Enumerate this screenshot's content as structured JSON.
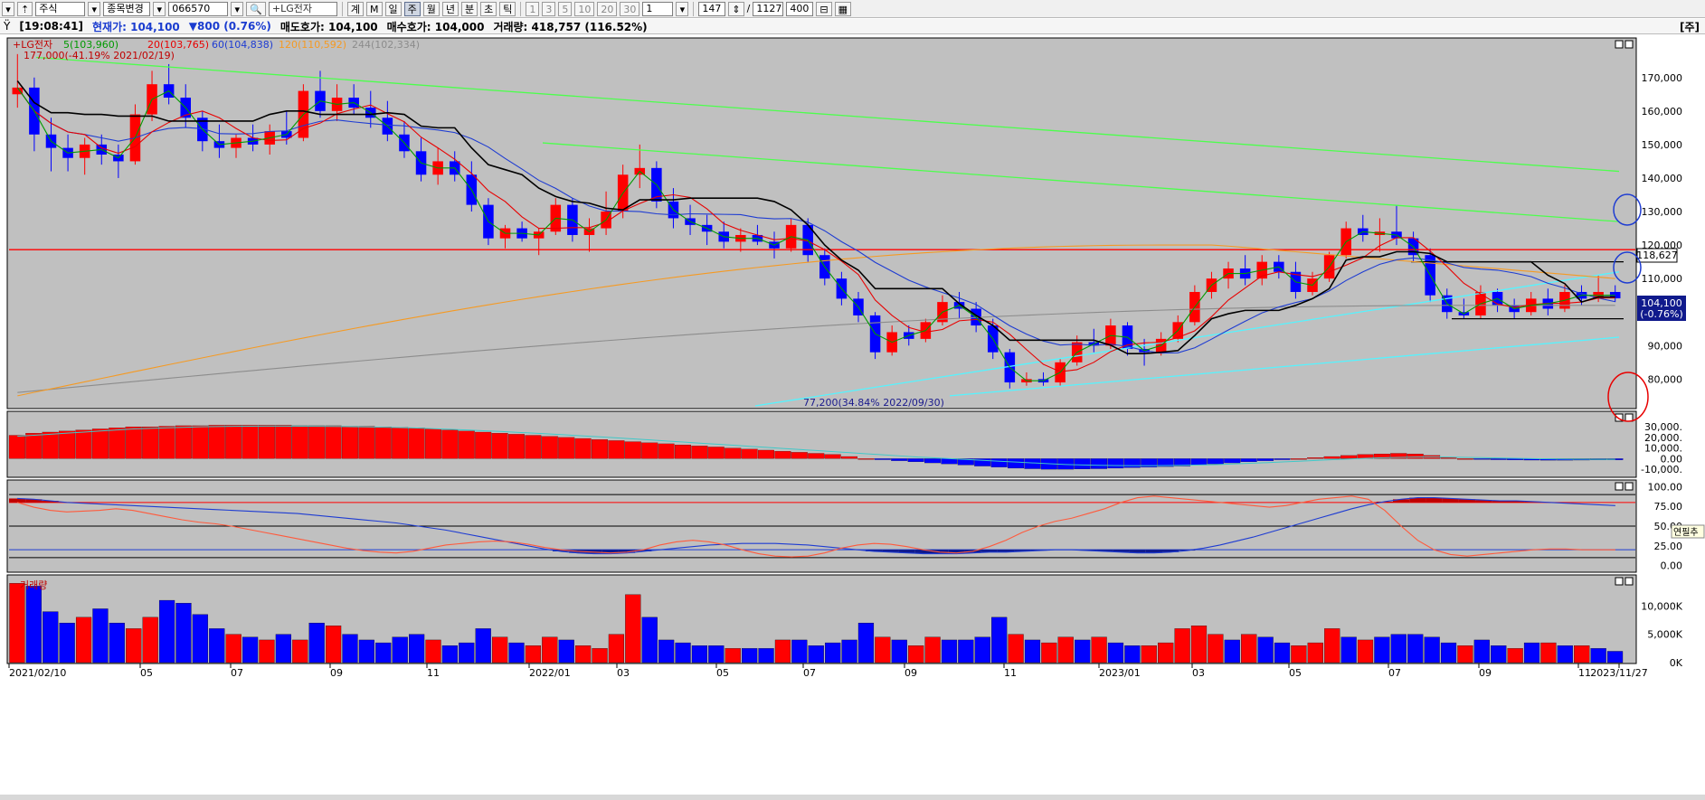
{
  "toolbar": {
    "market": "주식",
    "change_btn": "종목변경",
    "code": "066570",
    "name": "+LG전자",
    "periods": [
      "계",
      "M",
      "일",
      "주",
      "월",
      "년",
      "분",
      "초",
      "틱"
    ],
    "active_period": "주",
    "multipliers": [
      "1",
      "3",
      "5",
      "10",
      "20",
      "30"
    ],
    "unit": "1",
    "count": "147",
    "total": "1127",
    "view": "400"
  },
  "infobar": {
    "time": "[19:08:41]",
    "price_label": "현재가: 104,100",
    "change": "▼800 (0.76%)",
    "ask": "매도호가: 104,100",
    "bid": "매수호가: 104,000",
    "volume": "거래량: 418,757 (116.52%)",
    "right": "[주]"
  },
  "chart_data": [
    {
      "type": "candlestick",
      "title": "+LG전자",
      "legend": [
        "5(103,960)",
        "20(103,765)",
        "60(104,838)",
        "120(110,592)",
        "244(102,334)"
      ],
      "colors": {
        "up": "#ff0000",
        "down": "#0000ff",
        "ma5": "#009a00",
        "ma20": "#e80000",
        "ma60": "#1e3cd2",
        "ma120": "#f59a23",
        "ma244": "#8c8c8c",
        "ichimoku": "#000000",
        "hline": "#ff0000",
        "trend_green": "#4cff4c",
        "trend_cyan": "#54f4ff"
      },
      "high_note": "177,000(-41.19% 2021/02/19)",
      "low_note": "77,200(34.84% 2022/09/30)",
      "hline_label": "118,627",
      "price_label": [
        "104,100",
        "(-0.76%)"
      ],
      "ylim": [
        72000,
        181000
      ],
      "yticks": [
        "170,000",
        "160,000",
        "150,000",
        "140,000",
        "130,000",
        "120,000",
        "110,000",
        "100,000",
        "90,000",
        "80,000"
      ],
      "ytick_values": [
        170000,
        160000,
        150000,
        140000,
        130000,
        120000,
        110000,
        100000,
        90000,
        80000
      ],
      "x_dates": [
        "2021/02/10",
        "05",
        "07",
        "09",
        "11",
        "2022/01",
        "03",
        "05",
        "07",
        "09",
        "11",
        "2023/01",
        "03",
        "05",
        "07",
        "09",
        "11",
        "2023/11/27"
      ],
      "ohlc": [
        [
          165000,
          177000,
          161000,
          167000
        ],
        [
          167000,
          170000,
          148000,
          153000
        ],
        [
          153000,
          158000,
          142000,
          149000
        ],
        [
          149000,
          153000,
          142000,
          146000
        ],
        [
          146000,
          152000,
          141000,
          150000
        ],
        [
          150000,
          153000,
          144000,
          147000
        ],
        [
          147000,
          150000,
          140000,
          145000
        ],
        [
          145000,
          162000,
          144000,
          159000
        ],
        [
          159000,
          172000,
          157000,
          168000
        ],
        [
          168000,
          174000,
          162000,
          164000
        ],
        [
          164000,
          168000,
          155000,
          158000
        ],
        [
          158000,
          160000,
          148000,
          151000
        ],
        [
          151000,
          156000,
          146000,
          149000
        ],
        [
          149000,
          153000,
          146000,
          152000
        ],
        [
          152000,
          156000,
          148000,
          150000
        ],
        [
          150000,
          156000,
          147000,
          154000
        ],
        [
          154000,
          160000,
          150000,
          152000
        ],
        [
          152000,
          168000,
          151000,
          166000
        ],
        [
          166000,
          172000,
          158000,
          160000
        ],
        [
          160000,
          168000,
          157000,
          164000
        ],
        [
          164000,
          168000,
          159000,
          161000
        ],
        [
          161000,
          166000,
          155000,
          158000
        ],
        [
          158000,
          163000,
          151000,
          153000
        ],
        [
          153000,
          157000,
          146000,
          148000
        ],
        [
          148000,
          152000,
          139000,
          141000
        ],
        [
          141000,
          149000,
          138000,
          145000
        ],
        [
          145000,
          148000,
          139000,
          141000
        ],
        [
          141000,
          145000,
          130000,
          132000
        ],
        [
          132000,
          134000,
          120000,
          122000
        ],
        [
          122000,
          126000,
          119000,
          125000
        ],
        [
          125000,
          127000,
          121000,
          122000
        ],
        [
          122000,
          125000,
          117000,
          124000
        ],
        [
          124000,
          134000,
          123000,
          132000
        ],
        [
          132000,
          134000,
          121000,
          123000
        ],
        [
          123000,
          128000,
          118000,
          125000
        ],
        [
          125000,
          136000,
          123000,
          130000
        ],
        [
          130000,
          144000,
          128000,
          141000
        ],
        [
          141000,
          150000,
          137000,
          143000
        ],
        [
          143000,
          145000,
          131000,
          133000
        ],
        [
          133000,
          137000,
          125000,
          128000
        ],
        [
          128000,
          132000,
          123000,
          126000
        ],
        [
          126000,
          129000,
          120000,
          124000
        ],
        [
          124000,
          127000,
          119000,
          121000
        ],
        [
          121000,
          125000,
          118000,
          123000
        ],
        [
          123000,
          126000,
          120000,
          121000
        ],
        [
          121000,
          124000,
          116000,
          119000
        ],
        [
          119000,
          128000,
          118000,
          126000
        ],
        [
          126000,
          128000,
          115000,
          117000
        ],
        [
          117000,
          119000,
          108000,
          110000
        ],
        [
          110000,
          112000,
          102000,
          104000
        ],
        [
          104000,
          106000,
          97000,
          99000
        ],
        [
          99000,
          100000,
          86000,
          88000
        ],
        [
          88000,
          96000,
          87000,
          94000
        ],
        [
          94000,
          96000,
          90000,
          92000
        ],
        [
          92000,
          98000,
          91000,
          97000
        ],
        [
          97000,
          105000,
          96000,
          103000
        ],
        [
          103000,
          106000,
          98000,
          101000
        ],
        [
          101000,
          103000,
          94000,
          96000
        ],
        [
          96000,
          98000,
          86000,
          88000
        ],
        [
          88000,
          89000,
          77200,
          79000
        ],
        [
          79000,
          82000,
          78000,
          80000
        ],
        [
          80000,
          82000,
          78000,
          79000
        ],
        [
          79000,
          86000,
          78000,
          85000
        ],
        [
          85000,
          93000,
          84000,
          91000
        ],
        [
          91000,
          95000,
          88000,
          90000
        ],
        [
          90000,
          98000,
          89000,
          96000
        ],
        [
          96000,
          97000,
          87000,
          89000
        ],
        [
          89000,
          92000,
          84000,
          88000
        ],
        [
          88000,
          94000,
          87000,
          92000
        ],
        [
          92000,
          99000,
          91000,
          97000
        ],
        [
          97000,
          108000,
          96000,
          106000
        ],
        [
          106000,
          112000,
          104000,
          110000
        ],
        [
          110000,
          115000,
          107000,
          113000
        ],
        [
          113000,
          117000,
          108000,
          110000
        ],
        [
          110000,
          117000,
          108000,
          115000
        ],
        [
          115000,
          117000,
          110000,
          112000
        ],
        [
          112000,
          115000,
          104000,
          106000
        ],
        [
          106000,
          112000,
          105000,
          110000
        ],
        [
          110000,
          118000,
          109000,
          117000
        ],
        [
          117000,
          127000,
          116000,
          125000
        ],
        [
          125000,
          129000,
          121000,
          123000
        ],
        [
          123000,
          128000,
          118000,
          124000
        ],
        [
          124000,
          132000,
          120000,
          122000
        ],
        [
          122000,
          124000,
          115000,
          117000
        ],
        [
          117000,
          119000,
          103000,
          105000
        ],
        [
          105000,
          107000,
          98000,
          100000
        ],
        [
          100000,
          104000,
          98000,
          99000
        ],
        [
          99000,
          108000,
          98000,
          106000
        ],
        [
          106000,
          107000,
          100000,
          102000
        ],
        [
          102000,
          104000,
          98000,
          100000
        ],
        [
          100000,
          106000,
          99000,
          104000
        ],
        [
          104000,
          107000,
          99000,
          101000
        ],
        [
          101000,
          108000,
          100000,
          106000
        ],
        [
          106000,
          108000,
          102000,
          104000
        ],
        [
          104000,
          111000,
          103000,
          106000
        ],
        [
          106000,
          108000,
          103000,
          104100
        ]
      ]
    },
    {
      "type": "histogram",
      "yticks": [
        "30,000.",
        "20,000.",
        "10,000.",
        "0.00",
        "-10,000."
      ],
      "ytick_values": [
        30000,
        20000,
        10000,
        0,
        -10000
      ],
      "ylim": [
        -15000,
        42000
      ],
      "tooltip": "연필추",
      "values": [
        22000,
        24000,
        25000,
        26000,
        27000,
        28000,
        29000,
        30000,
        30000,
        30500,
        31000,
        31000,
        31500,
        31500,
        31500,
        31500,
        31500,
        31000,
        31000,
        31000,
        30500,
        30500,
        30000,
        29500,
        29000,
        28000,
        27000,
        26000,
        25000,
        24000,
        23000,
        22000,
        21000,
        20000,
        19000,
        18000,
        17000,
        16000,
        15000,
        14000,
        13000,
        12000,
        11000,
        10000,
        9000,
        8000,
        7000,
        6000,
        5000,
        4000,
        2000,
        0,
        -1000,
        -2000,
        -3000,
        -4000,
        -5000,
        -6000,
        -7000,
        -8000,
        -9000,
        -9500,
        -10000,
        -10000,
        -9800,
        -9500,
        -9000,
        -8500,
        -8000,
        -7500,
        -7000,
        -6000,
        -5000,
        -4000,
        -3000,
        -2000,
        -1000,
        0,
        1000,
        2000,
        3000,
        4000,
        4500,
        5000,
        4500,
        3000,
        1000,
        0,
        -500,
        -1000,
        -1200,
        -1400,
        -1500,
        -1500,
        -1400,
        -1300,
        -1200
      ],
      "signal": [
        21000,
        22000,
        23000,
        24000,
        25000,
        26000,
        27000,
        28000,
        28500,
        29000,
        29500,
        30000,
        30200,
        30400,
        30500,
        30600,
        30600,
        30500,
        30400,
        30300,
        30100,
        29900,
        29600,
        29200,
        28800,
        28200,
        27600,
        27000,
        26300,
        25600,
        24800,
        24000,
        23200,
        22300,
        21400,
        20500,
        19600,
        18600,
        17600,
        16600,
        15600,
        14600,
        13600,
        12600,
        11600,
        10600,
        9600,
        8600,
        7600,
        6600,
        5600,
        4600,
        3600,
        2600,
        1600,
        800,
        0,
        -800,
        -1600,
        -2400,
        -3200,
        -4000,
        -4800,
        -5500,
        -6000,
        -6300,
        -6500,
        -6600,
        -6600,
        -6500,
        -6300,
        -6000,
        -5600,
        -5000,
        -4400,
        -3800,
        -3100,
        -2400,
        -1700,
        -1000,
        -300,
        300,
        800,
        1200,
        1500,
        1600,
        1500,
        1200,
        900,
        600,
        300,
        0,
        -200,
        -400,
        -500,
        -600,
        -650
      ]
    },
    {
      "type": "line",
      "yticks": [
        "100.00",
        "75.00",
        "50.00",
        "25.00",
        "0.00"
      ],
      "ytick_values": [
        100,
        75,
        50,
        25,
        0
      ],
      "ylim": [
        -5,
        105
      ],
      "hlines": [
        90,
        80,
        50,
        20,
        10
      ],
      "series": [
        {
          "values": [
            85,
            84,
            82,
            80,
            79,
            78,
            77,
            76,
            75,
            74,
            73,
            72,
            71,
            70,
            69,
            68,
            67,
            66,
            64,
            62,
            60,
            58,
            56,
            54,
            51,
            48,
            45,
            41,
            37,
            33,
            29,
            25,
            21,
            18,
            16,
            15,
            15,
            16,
            18,
            20,
            22,
            24,
            26,
            27,
            28,
            28,
            28,
            27,
            26,
            24,
            22,
            20,
            18,
            17,
            16,
            15,
            15,
            15,
            16,
            17,
            17,
            18,
            19,
            20,
            20,
            19,
            18,
            17,
            16,
            16,
            17,
            19,
            22,
            26,
            31,
            36,
            42,
            48,
            54,
            60,
            66,
            72,
            77,
            81,
            84,
            86,
            86,
            85,
            84,
            83,
            82,
            82,
            81,
            80,
            79,
            78,
            77,
            76
          ]
        },
        {
          "values": [
            80,
            74,
            70,
            68,
            69,
            70,
            72,
            70,
            66,
            62,
            58,
            55,
            53,
            50,
            46,
            42,
            38,
            34,
            30,
            26,
            22,
            19,
            17,
            16,
            18,
            22,
            26,
            28,
            30,
            31,
            30,
            27,
            23,
            20,
            18,
            17,
            16,
            17,
            20,
            26,
            30,
            32,
            30,
            26,
            20,
            15,
            12,
            11,
            12,
            16,
            22,
            26,
            28,
            27,
            24,
            20,
            17,
            16,
            18,
            24,
            32,
            42,
            50,
            56,
            60,
            66,
            72,
            80,
            86,
            88,
            86,
            84,
            82,
            80,
            78,
            76,
            74,
            76,
            80,
            84,
            86,
            88,
            84,
            70,
            50,
            32,
            20,
            14,
            12,
            14,
            16,
            18,
            20,
            21,
            21,
            20,
            20,
            20
          ]
        }
      ]
    },
    {
      "type": "bar",
      "title": "거래량",
      "yticks": [
        "10,000K",
        "5,000K",
        "0K"
      ],
      "ytick_values": [
        10000,
        5000,
        0
      ],
      "ylim": [
        0,
        15000
      ],
      "values": [
        14000,
        13500,
        9000,
        7000,
        8000,
        9500,
        7000,
        6000,
        8000,
        11000,
        10500,
        8500,
        6000,
        5000,
        4500,
        4000,
        5000,
        4000,
        7000,
        6500,
        5000,
        4000,
        3500,
        4500,
        5000,
        4000,
        3000,
        3500,
        6000,
        4500,
        3500,
        3000,
        4500,
        4000,
        3000,
        2500,
        5000,
        12000,
        8000,
        4000,
        3500,
        3000,
        3000,
        2500,
        2500,
        2500,
        4000,
        4000,
        3000,
        3500,
        4000,
        7000,
        4500,
        4000,
        3000,
        4500,
        4000,
        4000,
        4500,
        8000,
        5000,
        4000,
        3500,
        4500,
        4000,
        4500,
        3500,
        3000,
        3000,
        3500,
        6000,
        6500,
        5000,
        4000,
        5000,
        4500,
        3500,
        3000,
        3500,
        6000,
        4500,
        4000,
        4500,
        5000,
        5000,
        4500,
        3500,
        3000,
        4000,
        3000,
        2500,
        3500,
        3500,
        3000,
        3000,
        2500,
        2000
      ]
    }
  ]
}
